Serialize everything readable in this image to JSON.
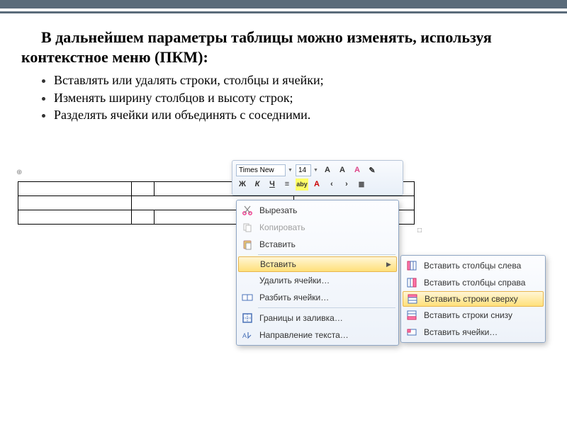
{
  "heading": "В дальнейшем параметры таблицы можно изменять, используя контекстное меню (ПКМ):",
  "bullets": [
    "Вставлять или удалять строки, столбцы и ячейки;",
    "Изменять ширину столбцов и высоту строк;",
    "Разделять ячейки или объединять с соседними."
  ],
  "mini_toolbar": {
    "font_name": "Times New",
    "font_size": "14",
    "row1_btns": [
      "A˘",
      "A˘",
      "A",
      "·"
    ],
    "row2_btns": [
      "Ж",
      "К",
      "Ч",
      "≡",
      "aby",
      "A",
      "·",
      "·"
    ]
  },
  "ctx_menu": [
    {
      "icon": "cut-icon",
      "label": "Вырезать",
      "u": 0
    },
    {
      "icon": "copy-icon",
      "label": "Копировать",
      "u": 0,
      "disabled": true
    },
    {
      "icon": "paste-icon",
      "label": "Вставить",
      "u": 3
    },
    {
      "sep": true
    },
    {
      "icon": "",
      "label": "Вставить",
      "u": 1,
      "arrow": true,
      "highlight": true
    },
    {
      "icon": "",
      "label": "Удалить ячейки…",
      "u": 0
    },
    {
      "icon": "split-icon",
      "label": "Разбить ячейки…",
      "u": 4
    },
    {
      "sep": true
    },
    {
      "icon": "borders-icon",
      "label": "Границы и заливка…",
      "u": 0
    },
    {
      "icon": "text-dir-icon",
      "label": "Направление текста…",
      "u": 0
    }
  ],
  "submenu": [
    {
      "icon": "insert-col-left-icon",
      "label": "Вставить столбцы слева"
    },
    {
      "icon": "insert-col-right-icon",
      "label": "Вставить столбцы справа"
    },
    {
      "icon": "insert-row-above-icon",
      "label": "Вставить строки сверху",
      "highlight": true
    },
    {
      "icon": "insert-row-below-icon",
      "label": "Вставить строки снизу"
    },
    {
      "icon": "insert-cells-icon",
      "label": "Вставить ячейки…"
    }
  ]
}
